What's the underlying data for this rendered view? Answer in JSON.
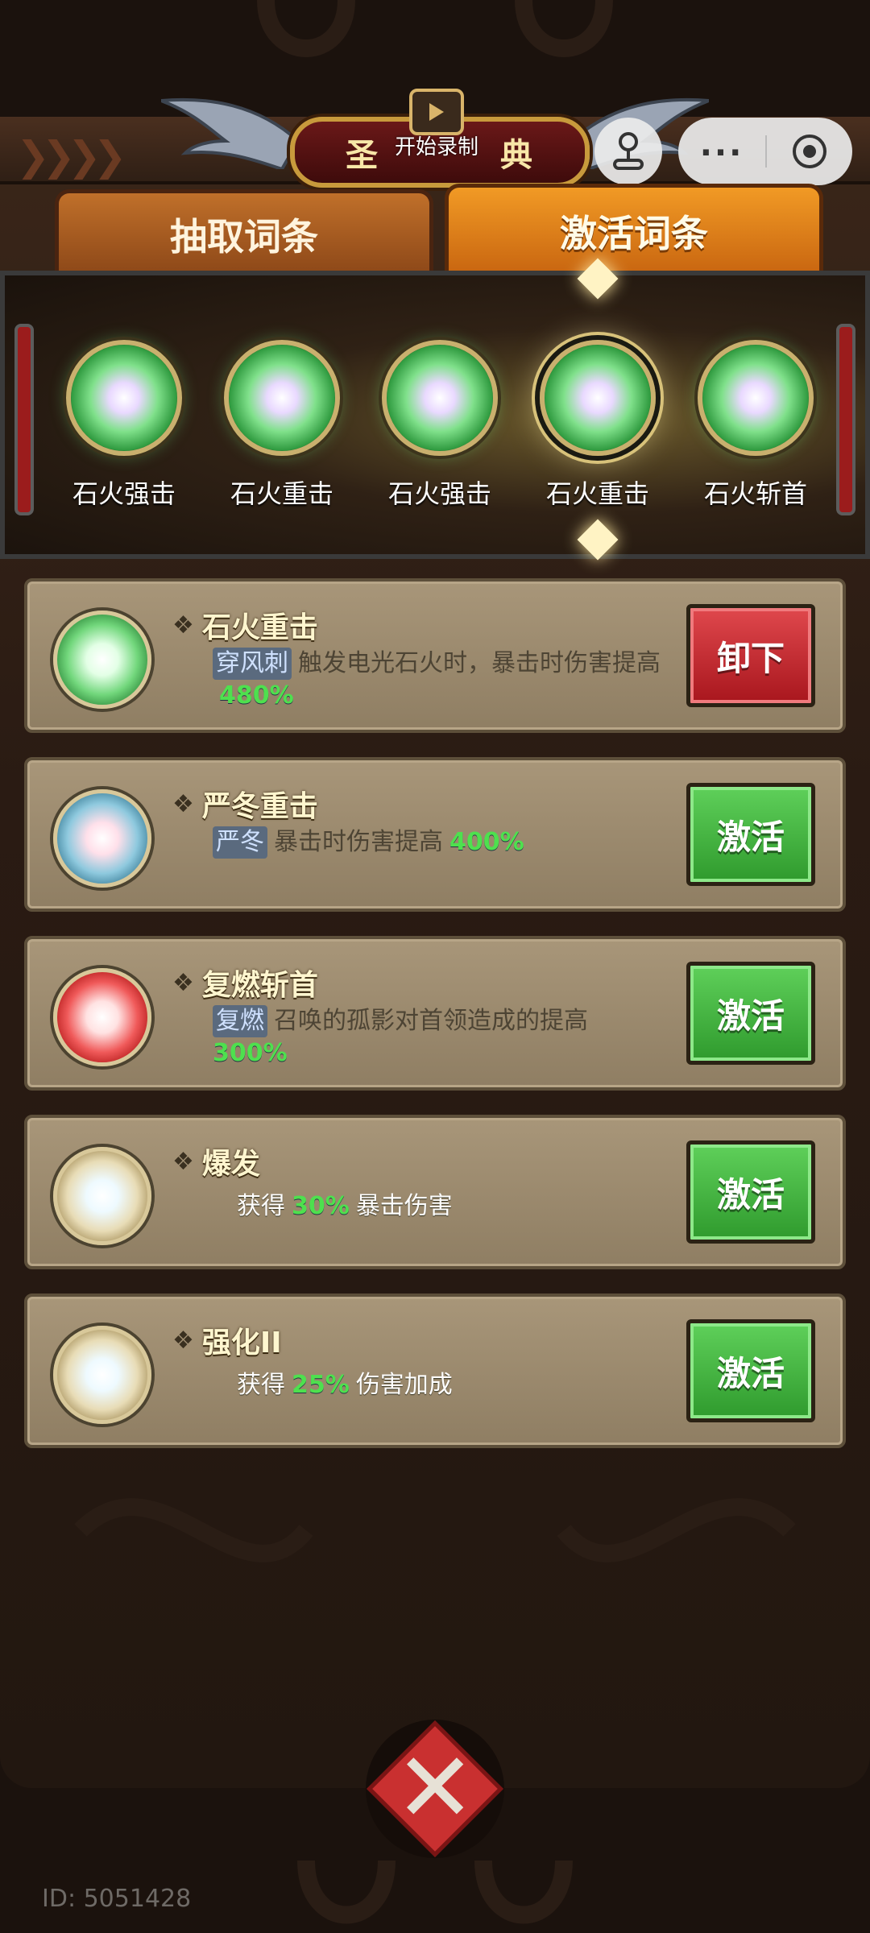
{
  "header": {
    "title": "圣",
    "title_end": "典",
    "record_label": "开始录制"
  },
  "tabs": [
    {
      "label": "抽取词条",
      "active": false
    },
    {
      "label": "激活词条",
      "active": true
    }
  ],
  "slots": [
    {
      "label": "石火强击",
      "selected": false
    },
    {
      "label": "石火重击",
      "selected": false
    },
    {
      "label": "石火强击",
      "selected": false
    },
    {
      "label": "石火重击",
      "selected": true
    },
    {
      "label": "石火斩首",
      "selected": false
    }
  ],
  "entries": [
    {
      "name": "石火重击",
      "tag": "穿风刺",
      "desc_before": "触发电光石火时，暴击时伤害提高",
      "value": "480%",
      "desc_after": "",
      "button": "卸下",
      "orb": "green"
    },
    {
      "name": "严冬重击",
      "tag": "严冬",
      "desc_before": "暴击时伤害提高",
      "value": "400%",
      "desc_after": "",
      "button": "激活",
      "orb": "blue"
    },
    {
      "name": "复燃斩首",
      "tag": "复燃",
      "desc_before": "召唤的孤影对首领造成的提高",
      "value": "300%",
      "desc_after": "",
      "button": "激活",
      "orb": "red"
    },
    {
      "name": "爆发",
      "tag": "",
      "desc_before": "获得",
      "value": "30%",
      "desc_after": "暴击伤害",
      "button": "激活",
      "orb": "gold"
    },
    {
      "name": "强化II",
      "tag": "",
      "desc_before": "获得",
      "value": "25%",
      "desc_after": "伤害加成",
      "button": "激活",
      "orb": "gold"
    }
  ],
  "footer": {
    "id_text": "ID: 5051428"
  },
  "colors": {
    "accent_orange": "#f19a25",
    "unload_red": "#c82a30",
    "activate_green": "#46b843",
    "value_green": "#4ee04e"
  }
}
